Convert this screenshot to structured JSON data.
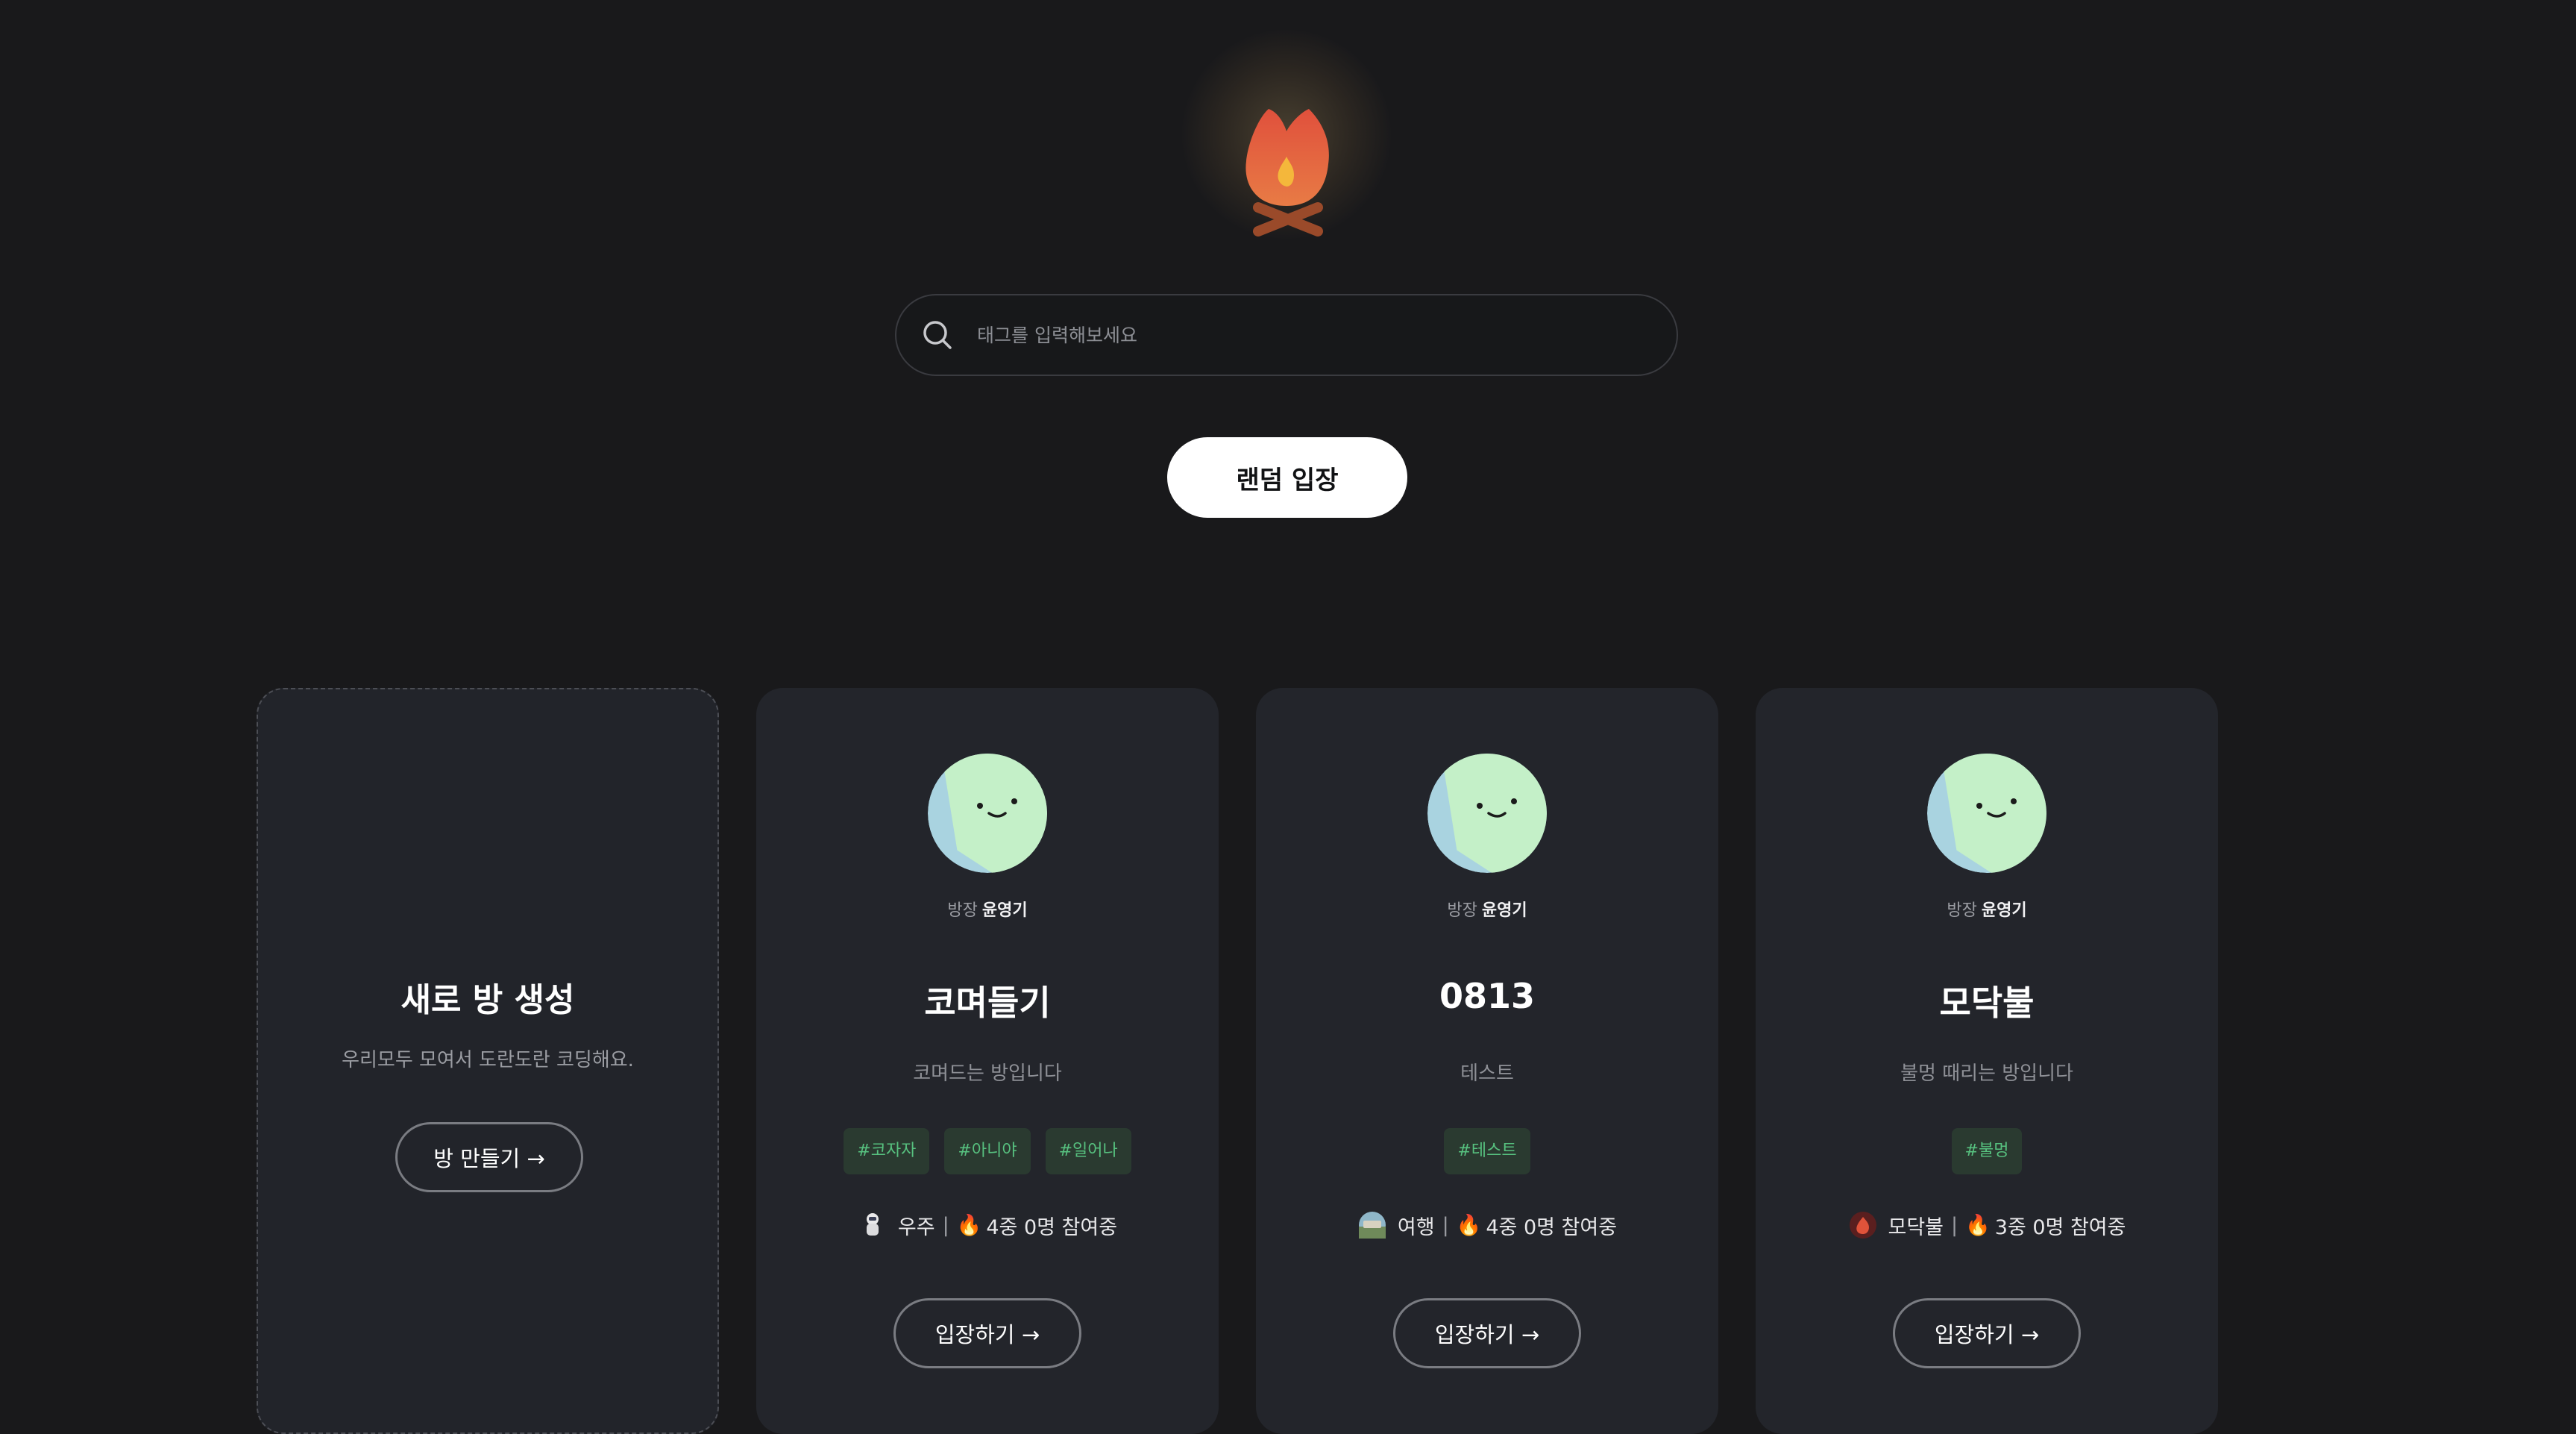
{
  "search": {
    "placeholder": "태그를 입력해보세요"
  },
  "random_button": {
    "label": "랜덤 입장"
  },
  "new_room": {
    "title": "새로 방 생성",
    "subtitle": "우리모두 모여서 도란도란 코딩해요.",
    "button": "방 만들기 →"
  },
  "rooms": [
    {
      "owner_label": "방장",
      "owner_name": "윤영기",
      "title": "코며들기",
      "description": "코며드는 방입니다",
      "tags": [
        "#코자자",
        "#아니야",
        "#일어나"
      ],
      "theme": "우주",
      "separator": "|",
      "fire_icon": "fire-icon",
      "status": "4중 0명 참여중",
      "button": "입장하기 →"
    },
    {
      "owner_label": "방장",
      "owner_name": "윤영기",
      "title": "0813",
      "description": "테스트",
      "tags": [
        "#테스트"
      ],
      "theme": "여행",
      "separator": "|",
      "fire_icon": "fire-icon",
      "status": "4중 0명 참여중",
      "button": "입장하기 →"
    },
    {
      "owner_label": "방장",
      "owner_name": "윤영기",
      "title": "모닥불",
      "description": "불멍 때리는 방입니다",
      "tags": [
        "#불멍"
      ],
      "theme": "모닥불",
      "separator": "|",
      "fire_icon": "fire-icon",
      "status": "3중 0명 참여중",
      "button": "입장하기 →"
    }
  ],
  "colors": {
    "background": "#19191b",
    "card": "#23252b",
    "tag_text": "#57c17f",
    "tag_bg": "#2a3a30",
    "flame": "#e0533a"
  }
}
